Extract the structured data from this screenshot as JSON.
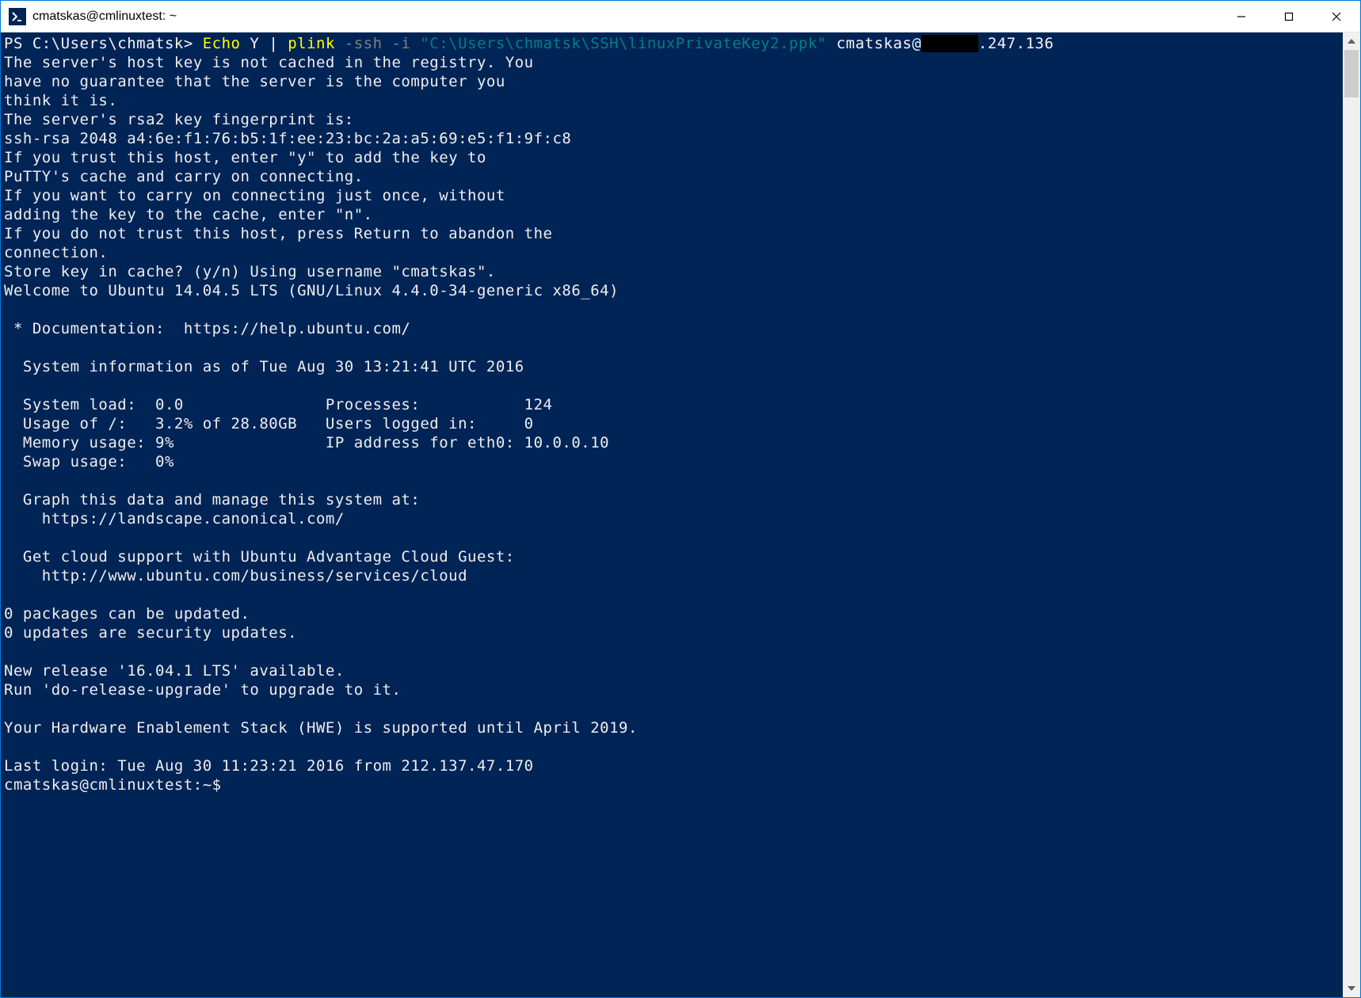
{
  "window": {
    "title": "cmatskas@cmlinuxtest: ~"
  },
  "prompt": {
    "ps": "PS C:\\Users\\chmatsk> ",
    "echo": "Echo",
    "y": " Y ",
    "pipe": "| ",
    "plink": "plink",
    "flags": " -ssh -i ",
    "keypath": "\"C:\\Users\\chmatsk\\SSH\\linuxPrivateKey2.ppk\"",
    "userhost1": " cmatskas@",
    "redacted": "      ",
    "userhost2": ".247.136"
  },
  "out": {
    "l01": "The server's host key is not cached in the registry. You",
    "l02": "have no guarantee that the server is the computer you",
    "l03": "think it is.",
    "l04": "The server's rsa2 key fingerprint is:",
    "l05": "ssh-rsa 2048 a4:6e:f1:76:b5:1f:ee:23:bc:2a:a5:69:e5:f1:9f:c8",
    "l06": "If you trust this host, enter \"y\" to add the key to",
    "l07": "PuTTY's cache and carry on connecting.",
    "l08": "If you want to carry on connecting just once, without",
    "l09": "adding the key to the cache, enter \"n\".",
    "l10": "If you do not trust this host, press Return to abandon the",
    "l11": "connection.",
    "l12": "Store key in cache? (y/n) Using username \"cmatskas\".",
    "l13": "Welcome to Ubuntu 14.04.5 LTS (GNU/Linux 4.4.0-34-generic x86_64)",
    "l14": "",
    "l15": " * Documentation:  https://help.ubuntu.com/",
    "l16": "",
    "l17": "  System information as of Tue Aug 30 13:21:41 UTC 2016",
    "l18": "",
    "l19": "  System load:  0.0               Processes:           124",
    "l20": "  Usage of /:   3.2% of 28.80GB   Users logged in:     0",
    "l21": "  Memory usage: 9%                IP address for eth0: 10.0.0.10",
    "l22": "  Swap usage:   0%",
    "l23": "",
    "l24": "  Graph this data and manage this system at:",
    "l25": "    https://landscape.canonical.com/",
    "l26": "",
    "l27": "  Get cloud support with Ubuntu Advantage Cloud Guest:",
    "l28": "    http://www.ubuntu.com/business/services/cloud",
    "l29": "",
    "l30": "0 packages can be updated.",
    "l31": "0 updates are security updates.",
    "l32": "",
    "l33": "New release '16.04.1 LTS' available.",
    "l34": "Run 'do-release-upgrade' to upgrade to it.",
    "l35": "",
    "l36": "Your Hardware Enablement Stack (HWE) is supported until April 2019.",
    "l37": "",
    "l38": "Last login: Tue Aug 30 11:23:21 2016 from 212.137.47.170",
    "l39": "cmatskas@cmlinuxtest:~$"
  }
}
